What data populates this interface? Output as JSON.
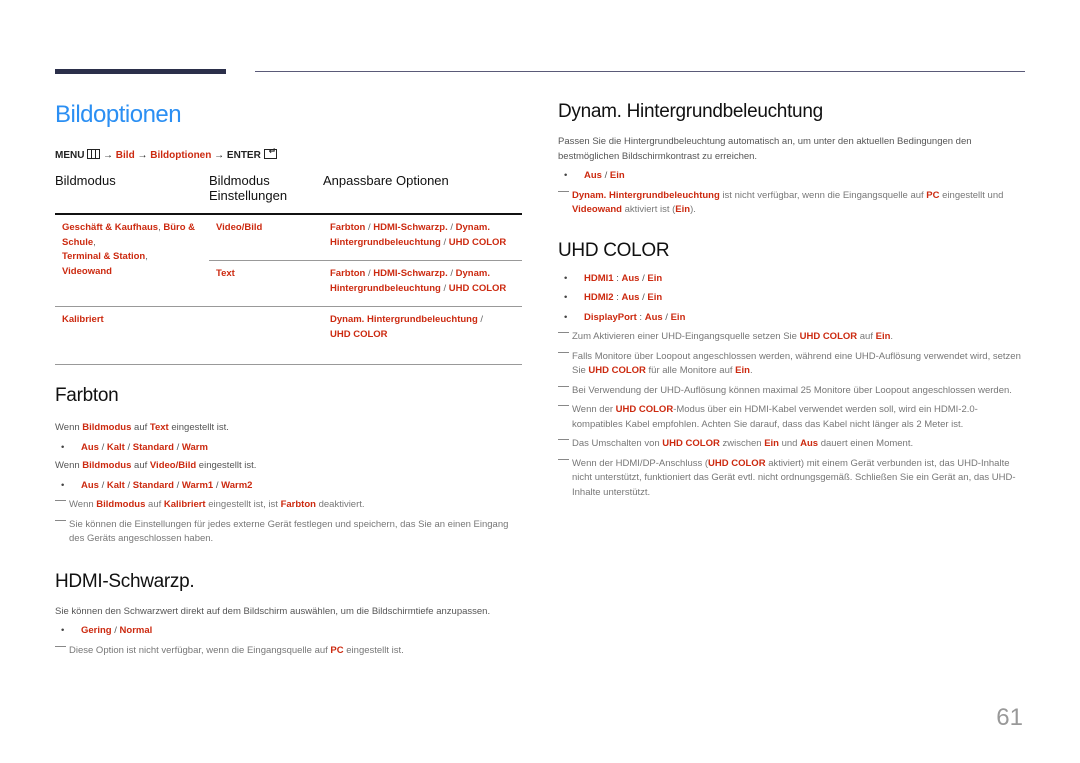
{
  "page": {
    "title": "Bildoptionen",
    "page_number": "61",
    "colors": {
      "title": "#2b8ff3",
      "highlight": "#cc2a10",
      "rule": "#2b2f4a"
    }
  },
  "menu_path": {
    "menu": "MENU",
    "menu_icon": "menu-grid-icon",
    "arrow": "→",
    "step1": "Bild",
    "step2": "Bildoptionen",
    "enter": "ENTER",
    "enter_icon": "enter-icon"
  },
  "table": {
    "headers": [
      "Bildmodus",
      "Bildmodus Einstellungen",
      "Anpassbare Optionen"
    ],
    "groups": [
      {
        "mode_parts": [
          "Geschäft & Kaufhaus",
          ", ",
          "Büro & Schule",
          ",",
          "Terminal & Station",
          ",",
          "Videowand"
        ],
        "rows": [
          {
            "setting": "Video/Bild",
            "options": [
              "Farbton",
              "HDMI-Schwarzp.",
              "Dynam. Hintergrundbeleuchtung",
              "UHD COLOR"
            ]
          },
          {
            "setting": "Text",
            "options": [
              "Farbton",
              "HDMI-Schwarzp.",
              "Dynam. Hintergrundbeleuchtung",
              "UHD COLOR"
            ]
          }
        ]
      },
      {
        "mode": "Kalibriert",
        "rows": [
          {
            "setting": "",
            "options": [
              "Dynam. Hintergrundbeleuchtung",
              "UHD COLOR"
            ]
          }
        ]
      }
    ],
    "separator": " / "
  },
  "farbton": {
    "heading": "Farbton",
    "cond1": {
      "pre": "Wenn ",
      "b1": "Bildmodus",
      "mid": " auf ",
      "b2": "Text",
      "post": " eingestellt ist."
    },
    "options1": [
      "Aus",
      "Kalt",
      "Standard",
      "Warm"
    ],
    "cond2": {
      "pre": "Wenn ",
      "b1": "Bildmodus",
      "mid": " auf ",
      "b2": "Video/Bild",
      "post": " eingestellt ist."
    },
    "options2": [
      "Aus",
      "Kalt",
      "Standard",
      "Warm1",
      "Warm2"
    ],
    "note1": {
      "pre": "Wenn ",
      "b1": "Bildmodus",
      "mid1": " auf ",
      "b2": "Kalibriert",
      "mid2": " eingestellt ist, ist ",
      "b3": "Farbton",
      "post": " deaktiviert."
    },
    "note2": "Sie können die Einstellungen für jedes externe Gerät festlegen und speichern, das Sie an einen Eingang des Geräts angeschlossen haben."
  },
  "hdmi": {
    "heading": "HDMI-Schwarzp.",
    "desc": "Sie können den Schwarzwert direkt auf dem Bildschirm auswählen, um die Bildschirmtiefe anzupassen.",
    "options": [
      "Gering",
      "Normal"
    ],
    "note": {
      "pre": "Diese Option ist nicht verfügbar, wenn die Eingangsquelle auf ",
      "b1": "PC",
      "post": " eingestellt ist."
    }
  },
  "dynam": {
    "heading": "Dynam. Hintergrundbeleuchtung",
    "desc": "Passen Sie die Hintergrundbeleuchtung automatisch an, um unter den aktuellen Bedingungen den bestmöglichen Bildschirmkontrast zu erreichen.",
    "options": [
      "Aus",
      "Ein"
    ],
    "note": {
      "b1": "Dynam. Hintergrundbeleuchtung",
      "mid1": " ist nicht verfügbar, wenn die Eingangsquelle auf ",
      "b2": "PC",
      "mid2": " eingestellt und ",
      "b3": "Videowand",
      "mid3": " aktiviert ist (",
      "b4": "Ein",
      "post": ")."
    }
  },
  "uhd": {
    "heading": "UHD COLOR",
    "items": [
      {
        "port": "HDMI1",
        "colon": " : ",
        "opts": [
          "Aus",
          "Ein"
        ]
      },
      {
        "port": "HDMI2",
        "colon": " : ",
        "opts": [
          "Aus",
          "Ein"
        ]
      },
      {
        "port": "DisplayPort",
        "colon": " : ",
        "opts": [
          "Aus",
          "Ein"
        ]
      }
    ],
    "note1": {
      "pre": "Zum Aktivieren einer UHD-Eingangsquelle setzen Sie ",
      "b1": "UHD COLOR",
      "mid": " auf ",
      "b2": "Ein",
      "post": "."
    },
    "note2": {
      "pre": "Falls Monitore über Loopout angeschlossen werden, während eine UHD-Auflösung verwendet wird, setzen Sie ",
      "b1": "UHD COLOR",
      "mid": " für alle Monitore auf ",
      "b2": "Ein",
      "post": "."
    },
    "note3": "Bei Verwendung der UHD-Auflösung können maximal 25 Monitore über Loopout angeschlossen werden.",
    "note4": {
      "pre": "Wenn der ",
      "b1": "UHD COLOR",
      "post": "-Modus über ein HDMI-Kabel verwendet werden soll, wird ein HDMI-2.0-kompatibles Kabel empfohlen. Achten Sie darauf, dass das Kabel nicht länger als 2 Meter ist."
    },
    "note5": {
      "pre": "Das Umschalten von ",
      "b1": "UHD COLOR",
      "mid1": " zwischen ",
      "b2": "Ein",
      "mid2": " und ",
      "b3": "Aus",
      "post": " dauert einen Moment."
    },
    "note6": {
      "pre": "Wenn der HDMI/DP-Anschluss (",
      "b1": "UHD COLOR",
      "post": " aktiviert) mit einem Gerät verbunden ist, das UHD-Inhalte nicht unterstützt, funktioniert das Gerät evtl. nicht ordnungsgemäß. Schließen Sie ein Gerät an, das UHD-Inhalte unterstützt."
    }
  }
}
